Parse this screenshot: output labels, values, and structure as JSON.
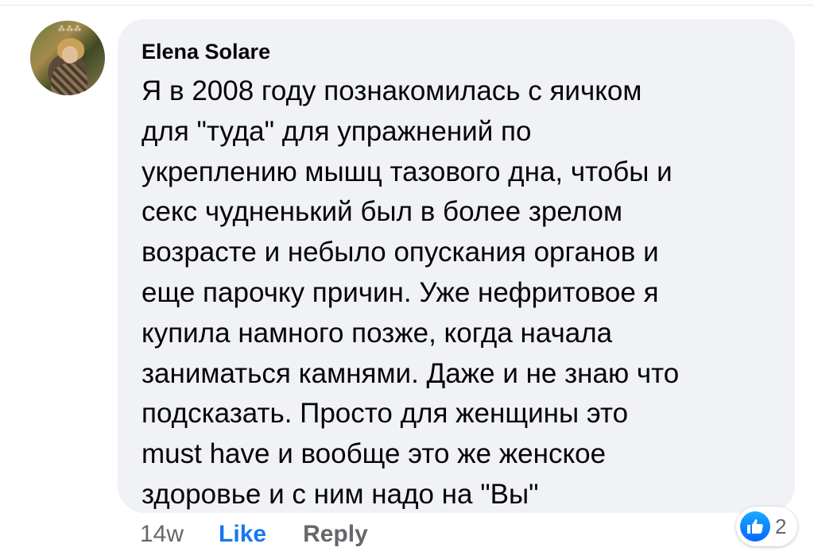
{
  "comment": {
    "author": "Elena Solare",
    "text": "Я в 2008 году познакомилась с яичком\nдля \"туда\" для упражнений по\nукреплению мышц тазового дна, чтобы и\nсекс чудненький был в более зрелом\nвозрасте и небыло опускания органов и\nеще парочку причин. Уже нефритовое я\nкупила намного позже, когда начала\nзаниматься камнями. Даже и не знаю что\nподсказать. Просто для женщины это\nmust have и вообще это же женское\nздоровье и с ним надо на \"Вы\"",
    "avatar_icon": "profile-photo",
    "bubble_color": "#f0f2f5"
  },
  "actions": {
    "time": "14w",
    "like_label": "Like",
    "reply_label": "Reply",
    "like_color": "#1877f2"
  },
  "reactions": {
    "icon": "thumbs-up-icon",
    "count": "2",
    "badge_color": "#1877f2"
  }
}
